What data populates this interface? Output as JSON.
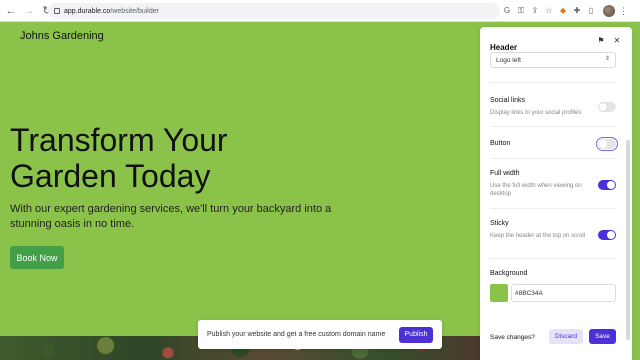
{
  "browser": {
    "url_host": "app.durable.co",
    "url_path": "/website/builder",
    "icons": [
      "back-arrow-icon",
      "forward-arrow-icon",
      "reload-icon",
      "lock-icon",
      "google-icon",
      "key-icon",
      "share-icon",
      "star-icon",
      "fox-extension-icon",
      "puzzle-extension-icon",
      "sidebar-icon",
      "avatar",
      "kebab-menu-icon"
    ]
  },
  "site": {
    "logo": "Johns Gardening",
    "hero_title": "Transform Your Garden Today",
    "hero_subtitle": "With our expert gardening services, we'll turn your backyard into a stunning oasis in no time.",
    "hero_button": "Book Now",
    "background_color": "#8BC34A"
  },
  "publish": {
    "text": "Publish your website and get a free custom domain name",
    "button": "Publish"
  },
  "panel": {
    "title": "Header",
    "layout_select": "Logo left",
    "social_links": {
      "label": "Social links",
      "desc": "Display links to your social profiles",
      "on": false
    },
    "button": {
      "label": "Button",
      "on": false,
      "focused": true
    },
    "full_width": {
      "label": "Full width",
      "desc": "Use the full width when viewing on desktop",
      "on": true
    },
    "sticky": {
      "label": "Sticky",
      "desc": "Keep the header at the top on scroll",
      "on": true
    },
    "background": {
      "label": "Background",
      "value": "#8BC34A",
      "swatch": "#8BC34A"
    },
    "footer": {
      "question": "Save changes?",
      "discard": "Discard",
      "save": "Save"
    },
    "accent": "#4C30D6"
  }
}
